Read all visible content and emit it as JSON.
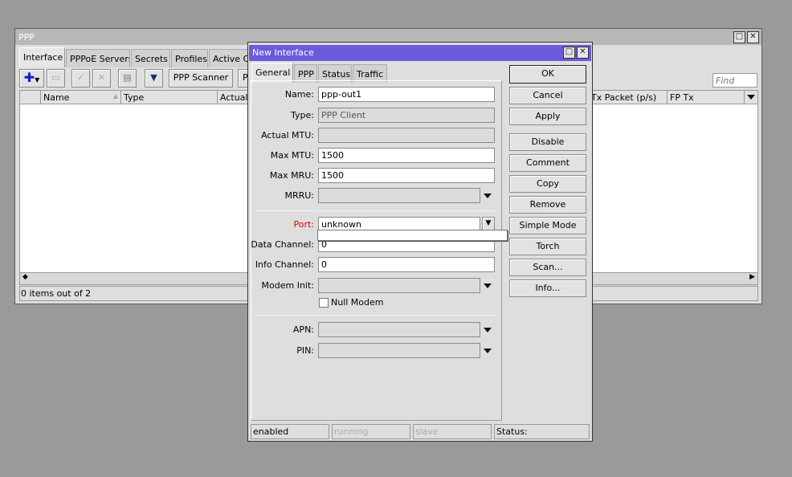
{
  "ppp_window": {
    "title": "PPP",
    "tabs": [
      "Interface",
      "PPPoE Servers",
      "Secrets",
      "Profiles",
      "Active Co"
    ],
    "toolbar": {
      "scanner": "PPP Scanner",
      "p": "P",
      "find_placeholder": "Find"
    },
    "columns": [
      "Name",
      "Type",
      "Actual M",
      "Tx Packet (p/s)",
      "FP Tx"
    ],
    "status": "0 items out of 2"
  },
  "dialog": {
    "title": "New Interface",
    "tabs": [
      "General",
      "PPP",
      "Status",
      "Traffic"
    ],
    "fields": {
      "name_label": "Name:",
      "name": "ppp-out1",
      "type_label": "Type:",
      "type": "PPP Client",
      "actual_mtu_label": "Actual MTU:",
      "actual_mtu": "",
      "max_mtu_label": "Max MTU:",
      "max_mtu": "1500",
      "max_mru_label": "Max MRU:",
      "max_mru": "1500",
      "mrru_label": "MRRU:",
      "mrru": "",
      "port_label": "Port:",
      "port": "unknown",
      "data_channel_label": "Data Channel:",
      "data_channel": "0",
      "info_channel_label": "Info Channel:",
      "info_channel": "0",
      "modem_init_label": "Modem Init:",
      "modem_init": "",
      "null_modem_label": "Null Modem",
      "null_modem": false,
      "apn_label": "APN:",
      "apn": "",
      "pin_label": "PIN:",
      "pin": ""
    },
    "buttons": [
      "OK",
      "Cancel",
      "Apply",
      "Disable",
      "Comment",
      "Copy",
      "Remove",
      "Simple Mode",
      "Torch",
      "Scan...",
      "Info..."
    ],
    "status": [
      "enabled",
      "running",
      "slave",
      "Status:"
    ]
  },
  "colors": {
    "dialog_title": "#6a5bdc",
    "port_label": "#e00000",
    "window_title": "#b8b8b8"
  }
}
